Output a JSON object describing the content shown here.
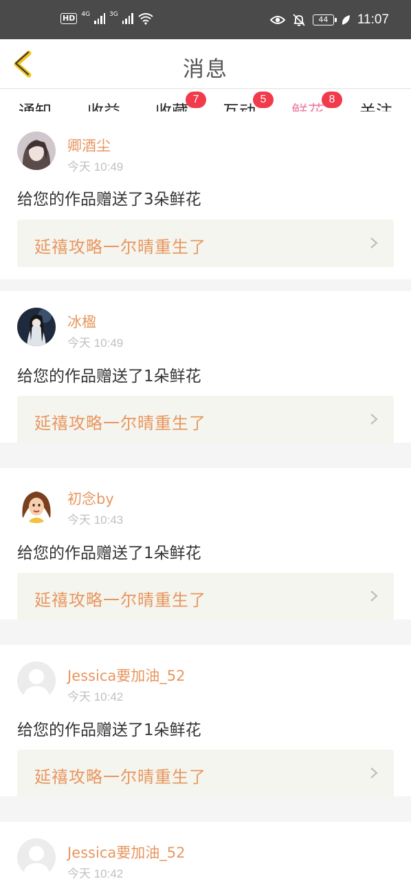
{
  "status_bar": {
    "hd": "HD",
    "net1": "4G",
    "net2": "3G",
    "wifi_sub": "6",
    "battery": "44",
    "time": "11:07"
  },
  "header": {
    "title": "消息"
  },
  "tabs": [
    {
      "label": "通知",
      "badge": ""
    },
    {
      "label": "收益",
      "badge": ""
    },
    {
      "label": "收藏",
      "badge": "7"
    },
    {
      "label": "互动",
      "badge": "5"
    },
    {
      "label": "鲜花",
      "badge": "8",
      "active": true
    },
    {
      "label": "关注",
      "badge": ""
    }
  ],
  "feed": [
    {
      "name": "卿酒尘",
      "time": "今天 10:49",
      "message": "给您的作品赠送了3朵鲜花",
      "work": "延禧攻略一尔晴重生了"
    },
    {
      "name": "冰楹",
      "time": "今天 10:49",
      "message": "给您的作品赠送了1朵鲜花",
      "work": "延禧攻略一尔晴重生了"
    },
    {
      "name": "初念by",
      "time": "今天 10:43",
      "message": "给您的作品赠送了1朵鲜花",
      "work": "延禧攻略一尔晴重生了"
    },
    {
      "name": "Jessica要加油_52",
      "time": "今天 10:42",
      "message": "给您的作品赠送了1朵鲜花",
      "work": "延禧攻略一尔晴重生了"
    },
    {
      "name": "Jessica要加油_52",
      "time": "今天 10:42",
      "message": "",
      "work": ""
    }
  ],
  "colors": {
    "accent": "#ef7fa3",
    "name": "#e7965f",
    "badge": "#f13a4b",
    "back": "#f2c21a"
  }
}
